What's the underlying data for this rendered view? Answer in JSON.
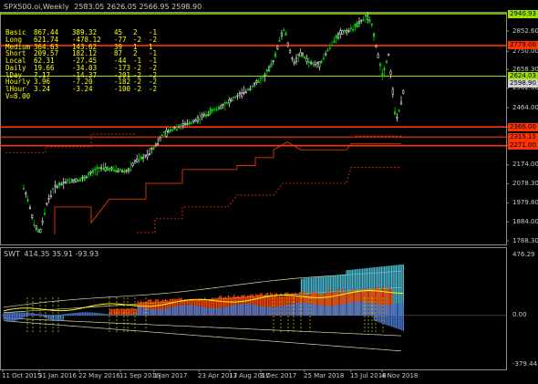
{
  "main_header": {
    "symbol": "SPX500.oi,Weekly",
    "ohlc": "2583.05 2626.05 2566.95 2598.90"
  },
  "indicator_table": {
    "rows": [
      {
        "label": "Basic",
        "v1": "867.44",
        "v2": "389.32",
        "v3": "45",
        "v4": "2",
        "v5": "-1"
      },
      {
        "label": "Long",
        "v1": "621.74",
        "v2": "-478.12",
        "v3": "-77",
        "v4": "-2",
        "v5": "-2"
      },
      {
        "label": "Medium",
        "v1": "364.63",
        "v2": "143.62",
        "v3": "39",
        "v4": "1",
        "v5": "1"
      },
      {
        "label": "Short",
        "v1": "209.57",
        "v2": "182.12",
        "v3": "87",
        "v4": "2",
        "v5": "-1"
      },
      {
        "label": "Local",
        "v1": "62.31",
        "v2": "-27.45",
        "v3": "-44",
        "v4": "-1",
        "v5": "-1"
      },
      {
        "label": "Daily",
        "v1": "19.66",
        "v2": "-34.03",
        "v3": "-173",
        "v4": "-2",
        "v5": "-2"
      },
      {
        "label": "lDay",
        "v1": "7.17",
        "v2": "-14.37",
        "v3": "-201",
        "v4": "-2",
        "v5": "-2"
      },
      {
        "label": "Hourly",
        "v1": "3.96",
        "v2": "-7.20",
        "v3": "-182",
        "v4": "-2",
        "v5": "-2"
      },
      {
        "label": "lHour",
        "v1": "3.24",
        "v2": "-3.24",
        "v3": "-100",
        "v4": "-2",
        "v5": "-2"
      }
    ],
    "footer": "V=8.00"
  },
  "price_axis": {
    "ticks": [
      "2852.60",
      "2750.00",
      "2658.30",
      "2562.60",
      "2464.00",
      "2366.00",
      "2271.60",
      "2174.00",
      "2078.30",
      "1979.80",
      "1884.00",
      "1788.30"
    ],
    "boxes": [
      {
        "text": "2940.93",
        "color": "#9be000"
      },
      {
        "text": "2779.00",
        "color": "#ff3300"
      },
      {
        "text": "2624.03",
        "color": "#9be000"
      },
      {
        "text": "2598.90",
        "color": "#d0d0d0"
      },
      {
        "text": "2366.00",
        "color": "#ff3300"
      },
      {
        "text": "2315.15",
        "color": "#ff3300"
      },
      {
        "text": "2271.00",
        "color": "#ff3300"
      }
    ]
  },
  "sub_header": {
    "name": "SWT",
    "values": "414.35 35.91 -93.93"
  },
  "sub_axis": {
    "top": "476.29",
    "zero": "0.00",
    "bottom": "-379.44"
  },
  "time_axis": {
    "labels": [
      "11 Oct 2015",
      "31 Jan 2016",
      "22 May 2016",
      "11 Sep 2016",
      "1 Jan 2017",
      "23 Apr 2017",
      "13 Aug 2017",
      "3 Dec 2017",
      "25 Mar 2018",
      "15 Jul 2018",
      "4 Nov 2018"
    ]
  },
  "colors": {
    "up_candle": "#00d000",
    "level_green": "#9be000",
    "level_red": "#ff3300",
    "text_yellow": "#ffff00",
    "axis_text": "#c8c8c8",
    "hist_blue": "#4a78d0",
    "hist_red": "#ff4a00",
    "hist_cyan": "#4ab8d0"
  }
}
